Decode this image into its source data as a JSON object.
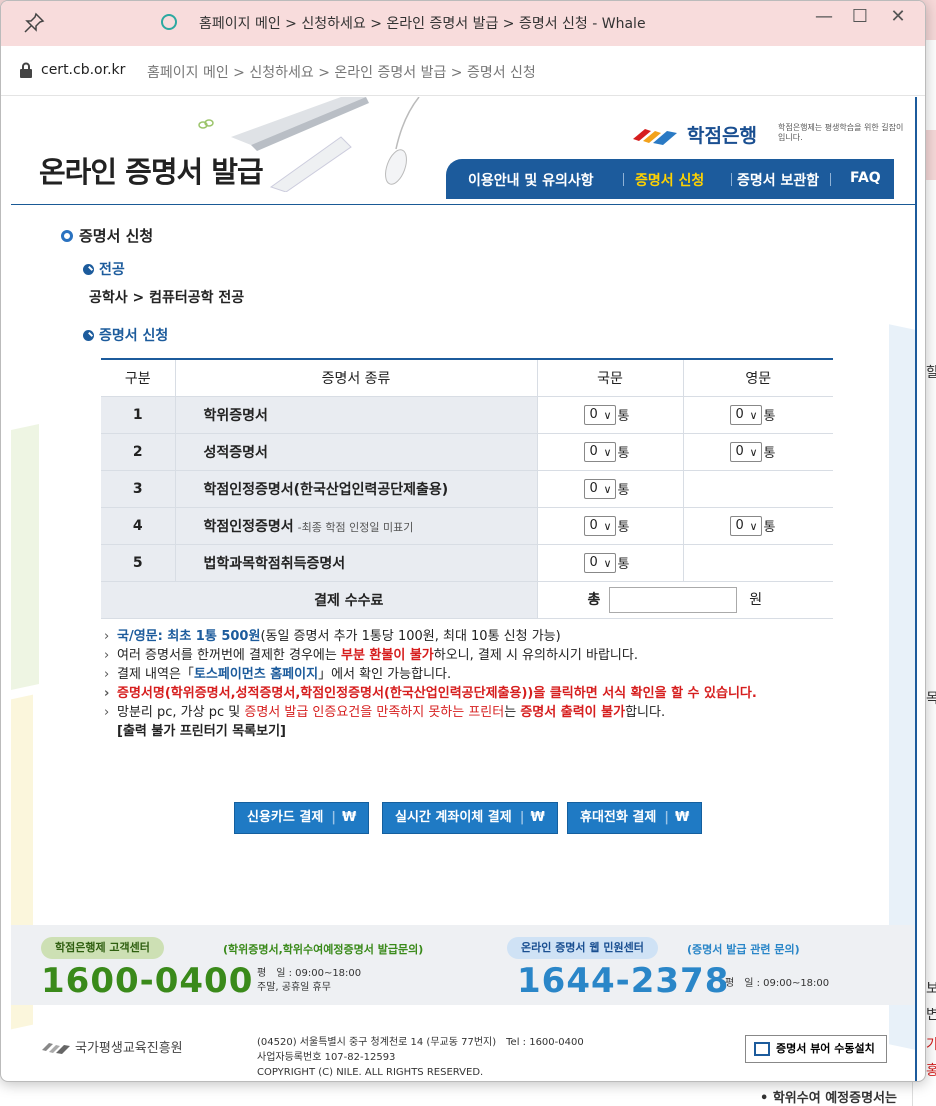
{
  "browser": {
    "title": "홈페이지 메인 > 신청하세요 > 온라인 증명서 발급 > 증명서 신청 - Whale",
    "url_host": "cert.cb.or.kr",
    "url_path": "홈페이지 메인 > 신청하세요 > 온라인 증명서 발급 > 증명서 신청",
    "minimize": "—",
    "maximize": "☐",
    "close": "✕"
  },
  "header": {
    "page_title": "온라인 증명서 발급",
    "logo_name": "학점은행",
    "logo_sub": "학점은행제는 평생학습을 위한 길잡이 입니다.",
    "nav": [
      "이용안내 및 유의사항",
      "증명서 신청",
      "증명서 보관함",
      "FAQ"
    ],
    "nav_active_color": "#ffd200"
  },
  "main": {
    "section_title": "증명서 신청",
    "major_label": "전공",
    "major_value": "공학사 > 컴퓨터공학 전공",
    "apply_label": "증명서 신청"
  },
  "table": {
    "headers": [
      "구분",
      "증명서 종류",
      "국문",
      "영문"
    ],
    "rows": [
      {
        "no": "1",
        "name": "학위증명서",
        "note": "",
        "kr": "0",
        "en": "0"
      },
      {
        "no": "2",
        "name": "성적증명서",
        "note": "",
        "kr": "0",
        "en": "0"
      },
      {
        "no": "3",
        "name": "학점인정증명서(한국산업인력공단제출용)",
        "note": "",
        "kr": "0",
        "en": ""
      },
      {
        "no": "4",
        "name": "학점인정증명서",
        "note": "-최종 학점 인정일 미표기",
        "kr": "0",
        "en": "0"
      },
      {
        "no": "5",
        "name": "법학과목학점취득증명서",
        "note": "",
        "kr": "0",
        "en": ""
      }
    ],
    "unit": "통",
    "fee_label": "결제 수수료",
    "fee_total_label": "총",
    "fee_currency": "원"
  },
  "notes": {
    "n1_blue": "국/영문: 최초 1통 500원",
    "n1_rest": "(동일 증명서 추가 1통당 100원, 최대 10통 신청 가능)",
    "n2_a": "여러 증명서를 한꺼번에 결제한 경우에는 ",
    "n2_red": "부분 환불이 불가",
    "n2_b": "하오니, 결제 시 유의하시기 바랍니다.",
    "n3_a": "결제 내역은「",
    "n3_blue": "토스페이먼츠 홈페이지",
    "n3_b": "」에서 확인 가능합니다.",
    "n4_red": "증명서명(학위증명서,성적증명서,학점인정증명서(한국산업인력공단제출용))을 클릭하면 서식 확인을 할 수 있습니다.",
    "n5_a": "망분리 pc, 가상 pc 및 ",
    "n5_red": "증명서 발급 인증요건을 만족하지 못하는 프린터",
    "n5_b": "는 ",
    "n5_red_b": "증명서 출력이 불가",
    "n5_c": "합니다.",
    "printer_link": "[출력 불가 프린터기 목록보기]"
  },
  "payment": {
    "card": "신용카드 결제",
    "transfer": "실시간 계좌이체 결제",
    "phone": "휴대전화 결제",
    "won_symbol": "₩"
  },
  "footer": {
    "center1_pill": "학점은행제 고객센터",
    "center1_note": "(학위증명서,학위수여예정증명서 발급문의)",
    "center1_phone": "1600-0400",
    "center1_hours_1": "평　일 : 09:00~18:00",
    "center1_hours_2": "주말, 공휴일 휴무",
    "center2_pill": "온라인 증명서 웹 민원센터",
    "center2_note": "(증명서 발급 관련 문의)",
    "center2_phone": "1644-2378",
    "center2_hours": "평　일 : 09:00~18:00",
    "agency": "국가평생교육진흥원",
    "address": "(04520) 서울특별시 중구 청계천로 14 (무교동 77번지)　Tel : 1600-0400",
    "business_no": "사업자등록번호 107-82-12593",
    "copyright": "COPYRIGHT (C) NILE. ALL RIGHTS RESERVED.",
    "viewer_button": "증명서 뷰어 수동설치"
  },
  "background": {
    "right_text_1": "할",
    "right_text_2": "목",
    "right_text_3": "보",
    "right_text_4": "변",
    "right_text_5": "가",
    "right_text_6": "홍",
    "bottom_text": "• 학위수여 예정증명서는"
  },
  "colors": {
    "brand_blue": "#1c5b9c",
    "accent_red": "#d61e1e",
    "phone_green": "#3a8a1a",
    "phone_blue": "#2a86c8"
  }
}
